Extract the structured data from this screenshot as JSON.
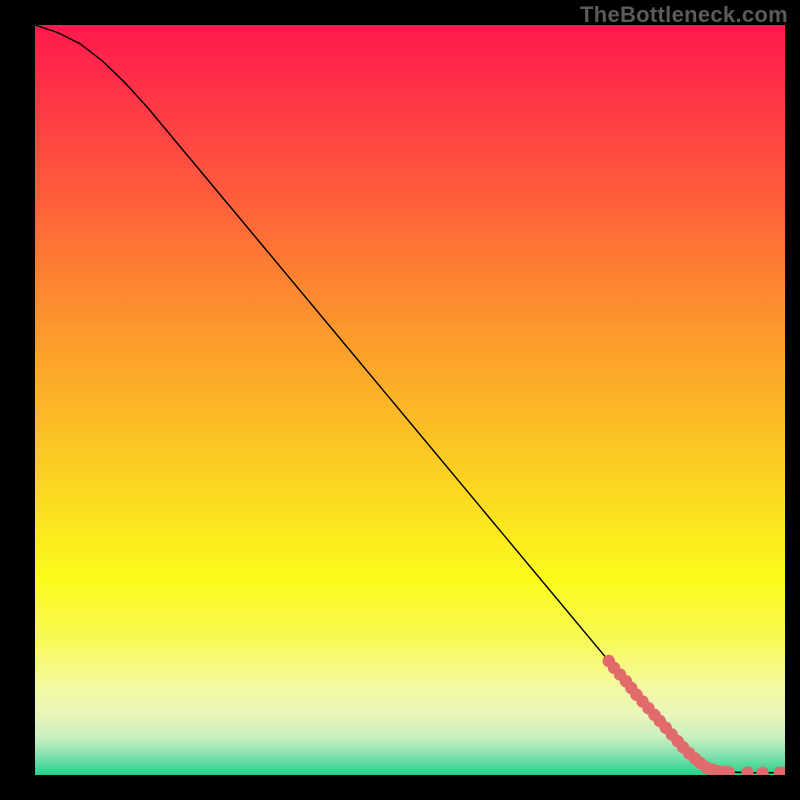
{
  "watermark": "TheBottleneck.com",
  "colors": {
    "curve": "#000000",
    "points": "#e16a6a"
  },
  "chart_data": {
    "type": "line",
    "title": "",
    "xlabel": "",
    "ylabel": "",
    "xlim": [
      0,
      100
    ],
    "ylim": [
      0,
      100
    ],
    "grid": false,
    "legend": false,
    "series": [
      {
        "name": "curve",
        "x": [
          0,
          3,
          6,
          9,
          12,
          15,
          20,
          30,
          40,
          50,
          60,
          70,
          80,
          85,
          88,
          90,
          92,
          94,
          96,
          98,
          100
        ],
        "y": [
          100,
          99,
          97.5,
          95.2,
          92.3,
          89,
          83,
          71,
          59,
          47,
          35,
          23,
          11,
          5,
          1.8,
          0.7,
          0.4,
          0.35,
          0.3,
          0.3,
          0.3
        ]
      }
    ],
    "highlight_points": {
      "x": [
        76.5,
        77.2,
        78.0,
        78.8,
        79.5,
        80.2,
        81.0,
        81.8,
        82.6,
        83.3,
        84.1,
        84.9,
        85.7,
        86.4,
        87.2,
        88.0,
        88.7,
        89.5,
        90.3,
        91.0,
        91.8,
        92.5,
        95.0,
        97.0,
        99.3,
        100.0
      ],
      "y": [
        15.2,
        14.3,
        13.4,
        12.5,
        11.6,
        10.7,
        9.8,
        8.9,
        8.0,
        7.2,
        6.3,
        5.4,
        4.5,
        3.7,
        2.9,
        2.2,
        1.6,
        1.0,
        0.7,
        0.5,
        0.4,
        0.35,
        0.32,
        0.3,
        0.3,
        0.3
      ]
    }
  }
}
